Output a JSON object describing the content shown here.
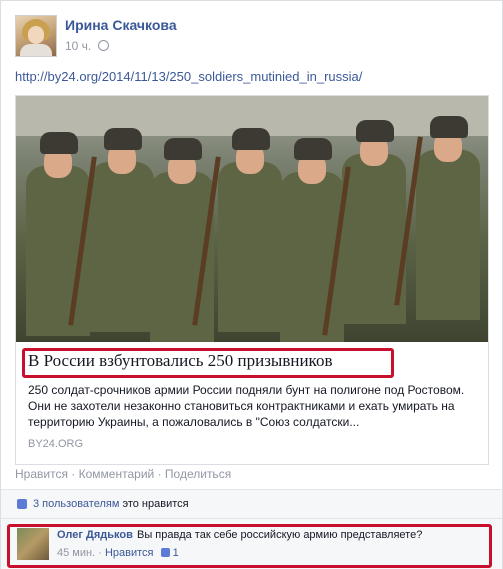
{
  "post": {
    "author": "Ирина Скачкова",
    "time": "10 ч.",
    "link_text": "http://by24.org/2014/11/13/250_soldiers_mutinied_in_russia/",
    "share": {
      "headline": "В России взбунтовались 250 призывников",
      "description": "250 солдат-срочников армии России подняли бунт на полигоне под Ростовом. Они не захотели незаконно становиться контрактниками и ехать умирать на территорию Украины, а пожаловались в \"Союз солдатски...",
      "domain": "BY24.ORG"
    },
    "actions": {
      "like": "Нравится",
      "comment": "Комментарий",
      "share": "Поделиться",
      "sep": "·"
    },
    "likes": {
      "count_text": "3 пользователям",
      "suffix": "это нравится"
    },
    "comment": {
      "author": "Олег Дядьков",
      "text": "Вы правда так себе российскую армию представляете?",
      "time": "45 мин.",
      "like": "Нравится",
      "likes": "1",
      "sep": "·"
    }
  },
  "colors": {
    "link": "#3b5998",
    "highlight": "#c8102e",
    "meta": "#9197a3"
  }
}
